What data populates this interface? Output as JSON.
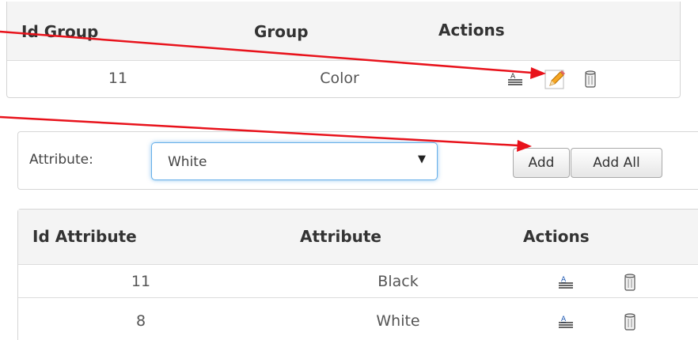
{
  "group_table": {
    "headers": {
      "id": "Id Group",
      "group": "Group",
      "actions": "Actions"
    },
    "rows": [
      {
        "id": "11",
        "group": "Color"
      }
    ],
    "row_action_icons": [
      "rename-icon",
      "edit-pencil-icon",
      "trash-icon"
    ]
  },
  "attribute_form": {
    "label": "Attribute:",
    "selected": "White",
    "add_label": "Add",
    "add_all_label": "Add All"
  },
  "attribute_table": {
    "headers": {
      "id": "Id Attribute",
      "attribute": "Attribute",
      "actions": "Actions"
    },
    "rows": [
      {
        "id": "11",
        "attribute": "Black"
      },
      {
        "id": "8",
        "attribute": "White"
      }
    ],
    "row_action_icons": [
      "rename-icon",
      "trash-icon"
    ]
  },
  "annotations": {
    "arrow_color": "#e8121b",
    "arrows": [
      "arrow-to-edit-icon",
      "arrow-to-add-button"
    ]
  }
}
